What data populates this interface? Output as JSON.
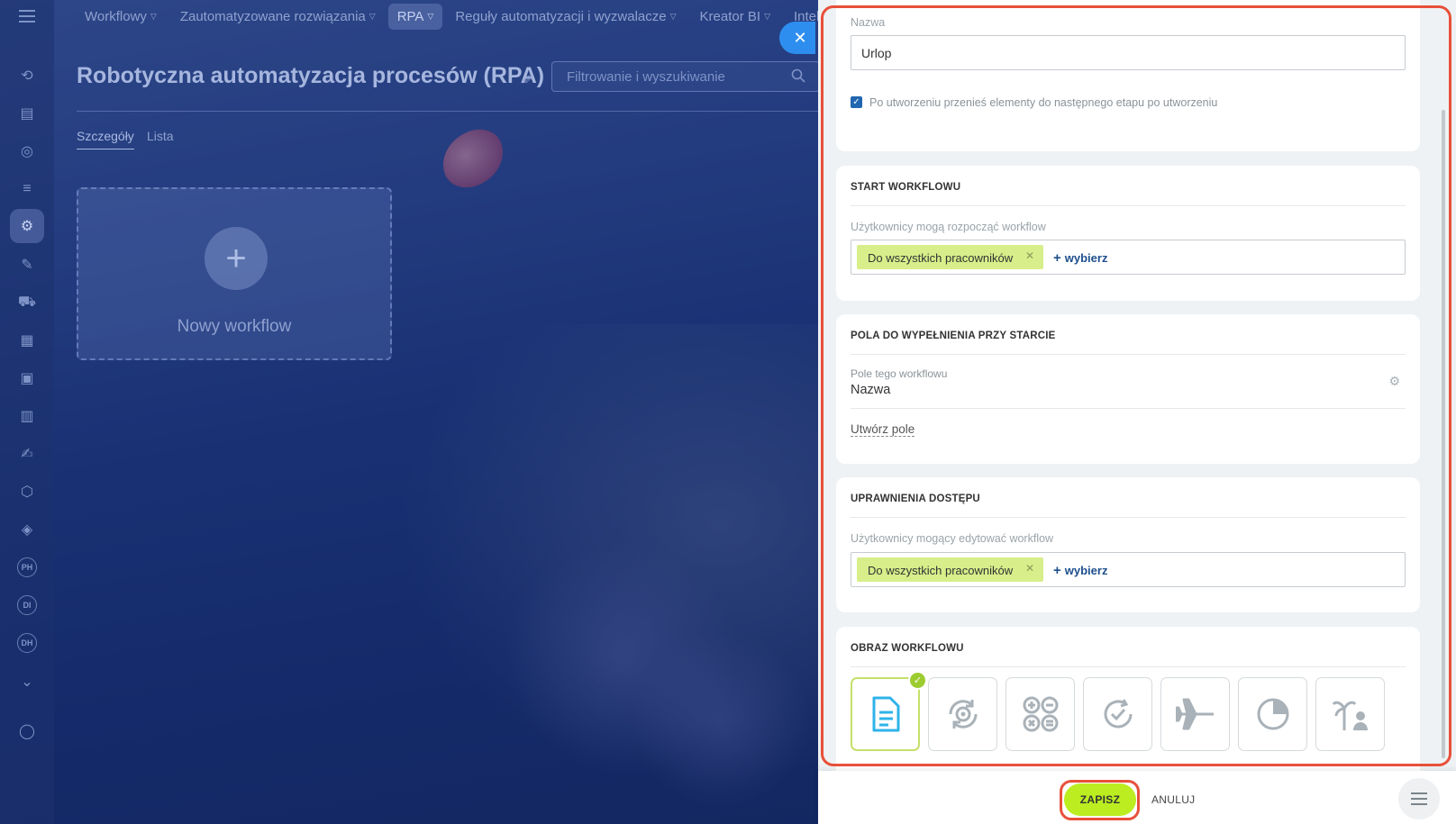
{
  "background": {
    "nav": [
      {
        "label": "Workflowy",
        "active": false
      },
      {
        "label": "Zautomatyzowane rozwiązania",
        "active": false
      },
      {
        "label": "RPA",
        "active": true
      },
      {
        "label": "Reguły automatyzacji i wyzwalacze",
        "active": false
      },
      {
        "label": "Kreator BI",
        "active": false
      },
      {
        "label": "Intel",
        "active": false
      }
    ],
    "page_title": "Robotyczna automatyzacja procesów (RPA)",
    "search_placeholder": "Filtrowanie i wyszukiwanie",
    "tabs": [
      "Szczegóły",
      "Lista"
    ],
    "new_card_label": "Nowy workflow",
    "rail_badges": [
      "PH",
      "DI",
      "DH"
    ]
  },
  "panel": {
    "name_section": {
      "label": "Nazwa",
      "value": "Urlop",
      "checkbox_label": "Po utworzeniu przenieś elementy do następnego etapu po utworzeniu",
      "checked": true
    },
    "start_section": {
      "title": "START WORKFLOWU",
      "field_label": "Użytkownicy mogą rozpocząć workflow",
      "tag": "Do wszystkich pracowników",
      "add_label": "wybierz"
    },
    "fields_section": {
      "title": "POLA DO WYPEŁNIENIA PRZY STARCIE",
      "field_label": "Pole tego workflowu",
      "field_value": "Nazwa",
      "create_link": "Utwórz pole"
    },
    "permissions_section": {
      "title": "UPRAWNIENIA DOSTĘPU",
      "field_label": "Użytkownicy mogący edytować workflow",
      "tag": "Do wszystkich pracowników",
      "add_label": "wybierz"
    },
    "image_section": {
      "title": "OBRAZ WORKFLOWU",
      "icons": [
        "document-icon",
        "gear-refresh-icon",
        "calculator-icon",
        "check-refresh-icon",
        "airplane-icon",
        "pie-chart-icon",
        "vacation-icon"
      ],
      "selected_index": 0
    }
  },
  "footer": {
    "save_label": "ZAPISZ",
    "cancel_label": "ANULUJ"
  },
  "colors": {
    "accent_green": "#bbed21",
    "tag_green": "#d7ee8a",
    "highlight_red": "#e8503a",
    "close_blue": "#2e8ef0",
    "selected_check": "#9ccc2f"
  }
}
